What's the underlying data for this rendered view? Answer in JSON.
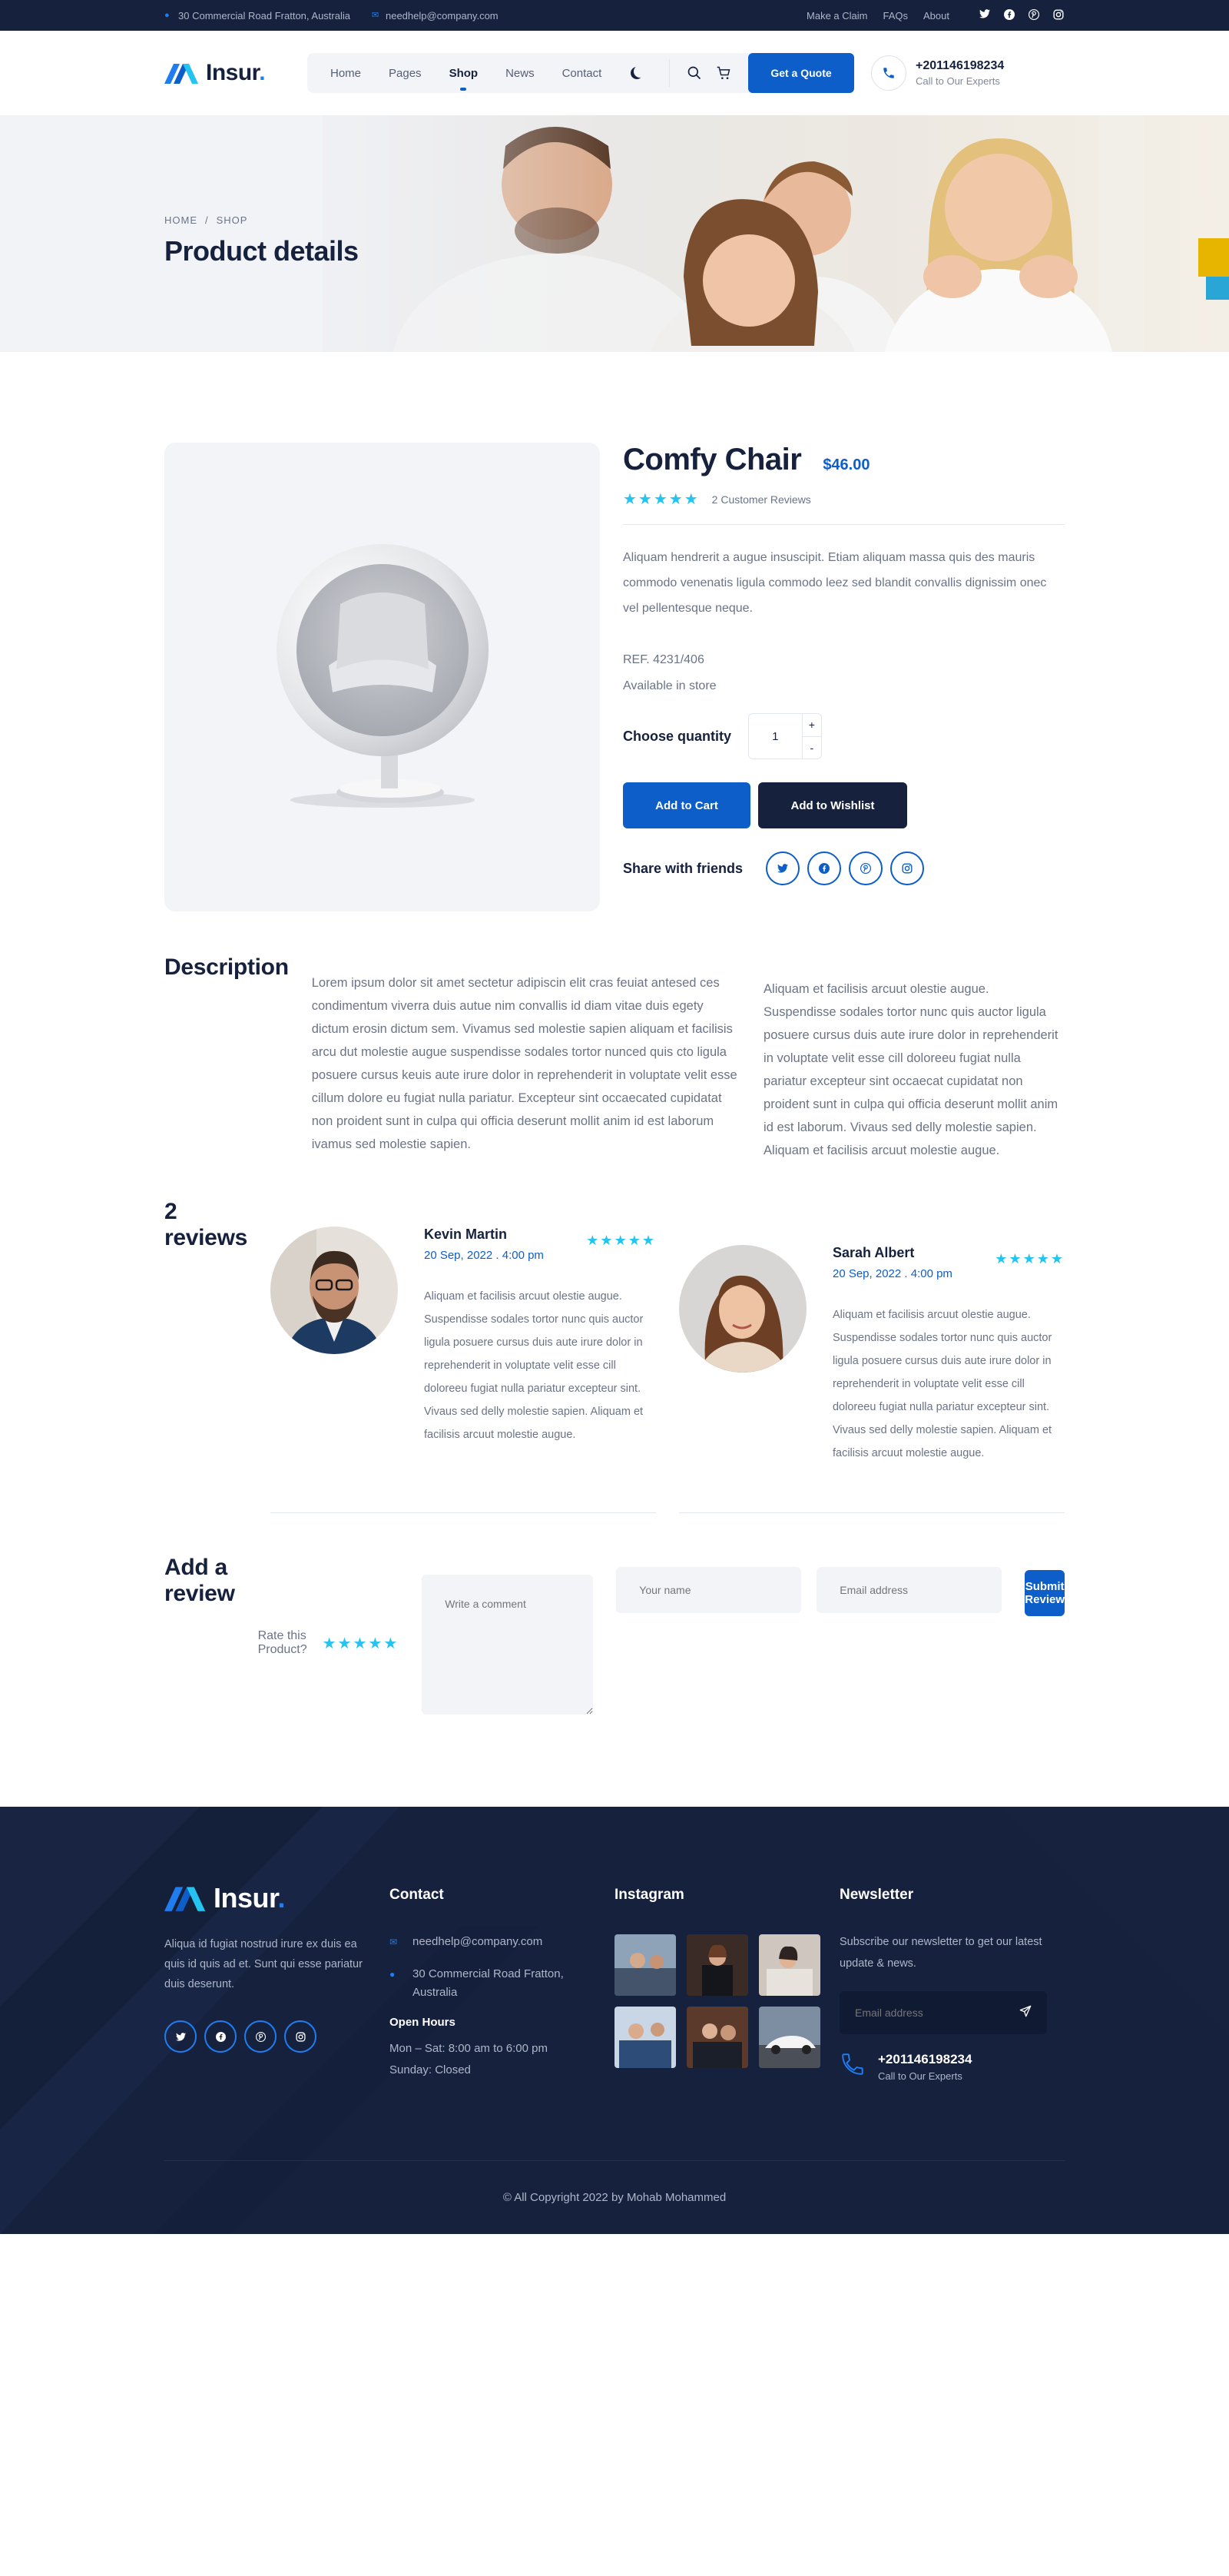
{
  "topbar": {
    "address": "30 Commercial Road Fratton, Australia",
    "email": "needhelp@company.com",
    "links": [
      "Make a Claim",
      "FAQs",
      "About"
    ],
    "socials": [
      "twitter-icon",
      "facebook-icon",
      "pinterest-icon",
      "instagram-icon"
    ]
  },
  "header": {
    "logo": "Insur",
    "logo_dot": ".",
    "nav": [
      "Home",
      "Pages",
      "Shop",
      "News",
      "Contact"
    ],
    "active_nav": "Shop",
    "quote_button": "Get a Quote",
    "phone": "+201146198234",
    "phone_sub": "Call to Our Experts"
  },
  "hero": {
    "breadcrumb_home": "HOME",
    "breadcrumb_sep": "/",
    "breadcrumb_current": "SHOP",
    "title": "Product details"
  },
  "product": {
    "title": "Comfy Chair",
    "price": "$46.00",
    "stars": "★★★★★",
    "reviews_count": "2 Customer Reviews",
    "description": "Aliquam hendrerit a augue insuscipit. Etiam aliquam massa quis des mauris commodo venenatis ligula commodo leez sed blandit convallis dignissim onec vel pellentesque neque.",
    "ref": "REF. 4231/406",
    "availability": "Available in store",
    "quantity_label": "Choose quantity",
    "quantity": "1",
    "qty_plus": "+",
    "qty_minus": "-",
    "add_to_cart": "Add to Cart",
    "add_to_wishlist": "Add to Wishlist",
    "share_label": "Share with friends"
  },
  "description": {
    "title": "Description",
    "p1": "Lorem ipsum dolor sit amet sectetur adipiscin elit cras feuiat antesed ces condimentum viverra duis autue nim convallis id diam vitae duis egety dictum erosin dictum sem. Vivamus sed molestie sapien aliquam et facilisis arcu dut molestie augue suspendisse sodales tortor nunced quis cto ligula posuere cursus keuis aute irure dolor in reprehenderit in voluptate velit esse cillum dolore eu fugiat nulla pariatur. Excepteur sint occaecated cupidatat non proident sunt in culpa qui officia deserunt mollit anim id est laborum ivamus sed molestie sapien.",
    "p2": "Aliquam et facilisis arcuut olestie augue. Suspendisse sodales tortor nunc quis auctor ligula posuere cursus duis aute irure dolor in reprehenderit in voluptate velit esse cill doloreeu fugiat nulla pariatur excepteur sint occaecat cupidatat non proident sunt in culpa qui officia deserunt mollit anim id est laborum. Vivaus sed delly molestie sapien. Aliquam et facilisis arcuut molestie augue."
  },
  "reviews": {
    "title": "2 reviews",
    "items": [
      {
        "name": "Kevin Martin",
        "date": "20 Sep, 2022 . 4:00 pm",
        "stars": "★★★★★",
        "text": "Aliquam et facilisis arcuut olestie augue. Suspendisse sodales tortor nunc quis auctor ligula posuere cursus duis aute irure dolor in reprehenderit in voluptate velit esse cill doloreeu fugiat nulla pariatur excepteur sint. Vivaus sed delly molestie sapien. Aliquam et facilisis arcuut molestie augue."
      },
      {
        "name": "Sarah Albert",
        "date": "20 Sep, 2022 . 4:00 pm",
        "stars": "★★★★★",
        "text": "Aliquam et facilisis arcuut olestie augue. Suspendisse sodales tortor nunc quis auctor ligula posuere cursus duis aute irure dolor in reprehenderit in voluptate velit esse cill doloreeu fugiat nulla pariatur excepteur sint. Vivaus sed delly molestie sapien. Aliquam et facilisis arcuut molestie augue."
      }
    ]
  },
  "add_review": {
    "title": "Add a review",
    "rate_label": "Rate this Product?",
    "stars": "★★★★★",
    "comment_placeholder": "Write a comment",
    "name_placeholder": "Your name",
    "email_placeholder": "Email address",
    "submit": "Submit Review"
  },
  "footer": {
    "logo": "Insur",
    "logo_dot": ".",
    "about": "Aliqua id fugiat nostrud irure ex duis ea quis id quis ad et. Sunt qui esse pariatur duis deserunt.",
    "contact_title": "Contact",
    "email": "needhelp@company.com",
    "address": "30 Commercial Road Fratton, Australia",
    "hours_title": "Open Hours",
    "hours_1": "Mon – Sat: 8:00 am to 6:00 pm",
    "hours_2": "Sunday: Closed",
    "instagram_title": "Instagram",
    "newsletter_title": "Newsletter",
    "newsletter_text": "Subscribe our newsletter to get our latest update & news.",
    "newsletter_placeholder": "Email address",
    "phone": "+201146198234",
    "phone_sub": "Call to Our Experts",
    "copyright": "© All Copyright 2022 by Mohab Mohammed"
  },
  "colors": {
    "brand_blue": "#0d5ec9",
    "navy": "#16213e",
    "star_cyan": "#25c4f0"
  }
}
